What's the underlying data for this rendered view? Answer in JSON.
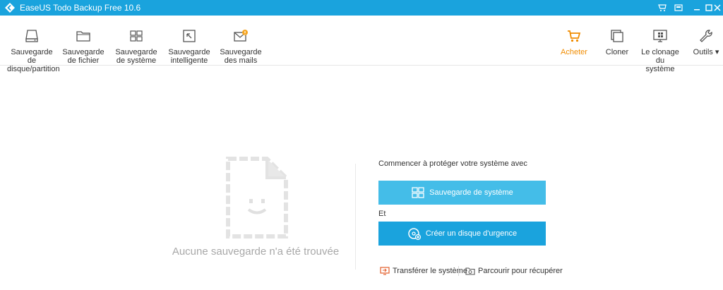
{
  "window": {
    "title": "EaseUS Todo Backup Free 10.6",
    "accent_color": "#1aa3dd"
  },
  "toolbar": {
    "left_items": [
      {
        "line1": "Sauvegarde de",
        "line2": "disque/partition",
        "icon": "disk-icon"
      },
      {
        "line1": "Sauvegarde",
        "line2": "de fichier",
        "icon": "folder-icon"
      },
      {
        "line1": "Sauvegarde",
        "line2": "de système",
        "icon": "windows-icon"
      },
      {
        "line1": "Sauvegarde",
        "line2": "intelligente",
        "icon": "smart-backup-icon"
      },
      {
        "line1": "Sauvegarde",
        "line2": "des mails",
        "icon": "mail-icon"
      }
    ],
    "right_items": [
      {
        "line1": "Acheter",
        "line2": "",
        "icon": "cart-icon",
        "color": "#f08c00"
      },
      {
        "line1": "Cloner",
        "line2": "",
        "icon": "clone-icon"
      },
      {
        "line1": "Le clonage du",
        "line2": "système",
        "icon": "system-clone-icon"
      },
      {
        "line1": "Outils ▾",
        "line2": "",
        "icon": "wrench-icon"
      }
    ]
  },
  "main": {
    "empty_message": "Aucune sauvegarde n'a été trouvée",
    "panel_title": "Commencer à protéger votre système avec",
    "system_backup_label": "Sauvegarde de système",
    "et_label": "Et",
    "rescue_disk_label": "Créer un disque  d'urgence",
    "transfer_label": "Transférer le système",
    "browse_label": "Parcourir pour récupérer"
  }
}
